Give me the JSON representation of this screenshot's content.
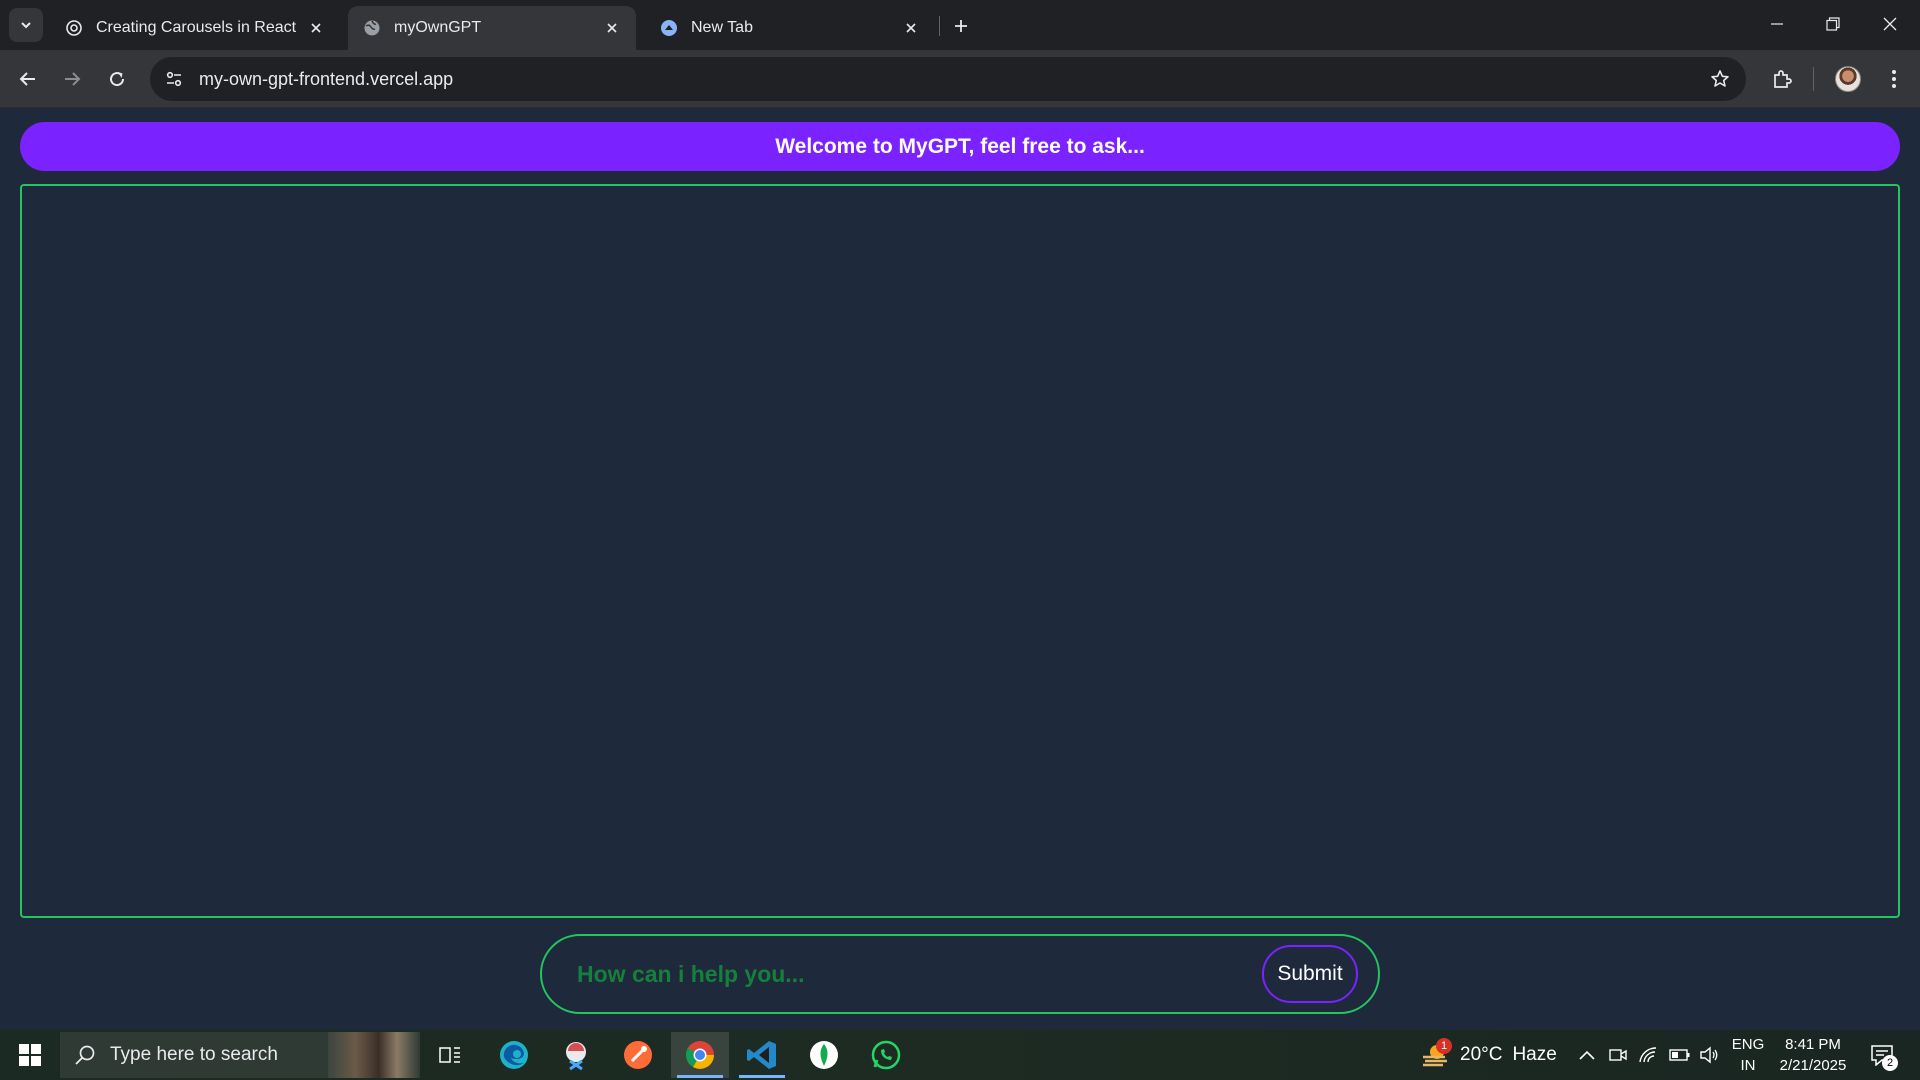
{
  "browser": {
    "tabs": [
      {
        "title": "Creating Carousels in React",
        "favicon": "openai-icon"
      },
      {
        "title": "myOwnGPT",
        "favicon": "globe-icon"
      },
      {
        "title": "New Tab",
        "favicon": "chrome-newtab-icon"
      }
    ],
    "url": "my-own-gpt-frontend.vercel.app"
  },
  "page": {
    "banner": "Welcome to MyGPT, feel free to ask...",
    "prompt_placeholder": "How can i help you...",
    "prompt_value": "",
    "submit_label": "Submit",
    "colors": {
      "accent": "#7a22ff",
      "border": "#22c55e",
      "background": "#1e293b"
    }
  },
  "taskbar": {
    "search_placeholder": "Type here to search",
    "weather": {
      "temp": "20°C",
      "condition": "Haze",
      "badge": "1"
    },
    "lang": [
      "ENG",
      "IN"
    ],
    "time": "8:41 PM",
    "date": "2/21/2025",
    "notifications": "2"
  }
}
